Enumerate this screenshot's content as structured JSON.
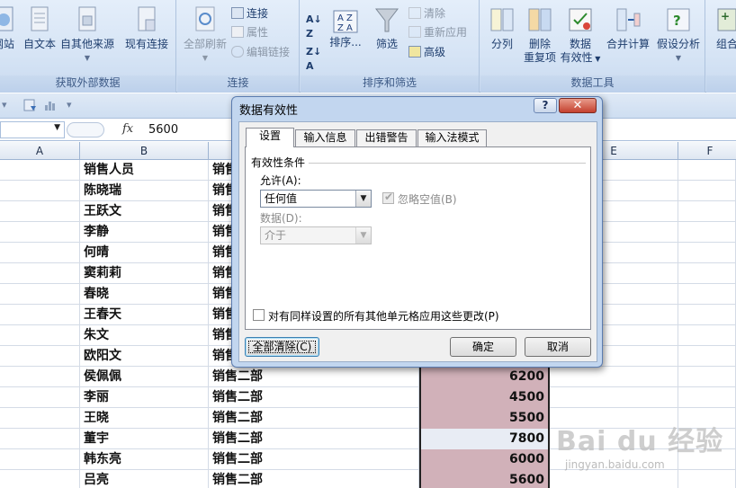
{
  "ribbon": {
    "groups": [
      {
        "label": "获取外部数据"
      },
      {
        "label": "连接"
      },
      {
        "label": "排序和筛选"
      },
      {
        "label": "数据工具"
      }
    ],
    "buttons": {
      "web": "网站",
      "text": "自文本",
      "other": "自其他来源",
      "existing": "现有连接",
      "refresh_all": "全部刷新",
      "connections": "连接",
      "properties": "属性",
      "edit_links": "编辑链接",
      "sort": "排序...",
      "filter": "筛选",
      "clear": "清除",
      "reapply": "重新应用",
      "advanced": "高级",
      "text_to_columns": "分列",
      "remove_dup_1": "删除",
      "remove_dup_2": "重复项",
      "validation_1": "数据",
      "validation_2": "有效性",
      "consolidate": "合并计算",
      "whatif": "假设分析",
      "group": "组合"
    }
  },
  "formula_bar": {
    "fx": "fx",
    "value": "5600"
  },
  "sheet": {
    "columns": [
      "A",
      "B",
      "E",
      "F"
    ],
    "rows": [
      {
        "b": "销售人员",
        "c": "销售",
        "d": ""
      },
      {
        "b": "陈晓瑞",
        "c": "销售",
        "d": ""
      },
      {
        "b": "王跃文",
        "c": "销售",
        "d": ""
      },
      {
        "b": "李静",
        "c": "销售",
        "d": ""
      },
      {
        "b": "何晴",
        "c": "销售",
        "d": ""
      },
      {
        "b": "窦莉莉",
        "c": "销售",
        "d": ""
      },
      {
        "b": "春晓",
        "c": "销售",
        "d": ""
      },
      {
        "b": "王春天",
        "c": "销售",
        "d": ""
      },
      {
        "b": "朱文",
        "c": "销售",
        "d": ""
      },
      {
        "b": "欧阳文",
        "c": "销售",
        "d": ""
      },
      {
        "b": "侯佩佩",
        "c": "销售二部",
        "d": "6200"
      },
      {
        "b": "李丽",
        "c": "销售二部",
        "d": "4500"
      },
      {
        "b": "王晓",
        "c": "销售二部",
        "d": "5500"
      },
      {
        "b": "董宇",
        "c": "销售二部",
        "d": "7800"
      },
      {
        "b": "韩东亮",
        "c": "销售二部",
        "d": "6000"
      },
      {
        "b": "吕亮",
        "c": "销售二部",
        "d": "5600"
      }
    ]
  },
  "dialog": {
    "title": "数据有效性",
    "help": "?",
    "close": "✕",
    "tabs": [
      "设置",
      "输入信息",
      "出错警告",
      "输入法模式"
    ],
    "section": "有效性条件",
    "allow_label": "允许(A):",
    "allow_value": "任何值",
    "ignore_blank": "忽略空值(B)",
    "data_label": "数据(D):",
    "data_value": "介于",
    "apply_all": "对有同样设置的所有其他单元格应用这些更改(P)",
    "clear_all": "全部清除(C)",
    "ok": "确定",
    "cancel": "取消"
  },
  "watermark": {
    "logo": "Bai du 经验",
    "url": "jingyan.baidu.com"
  }
}
